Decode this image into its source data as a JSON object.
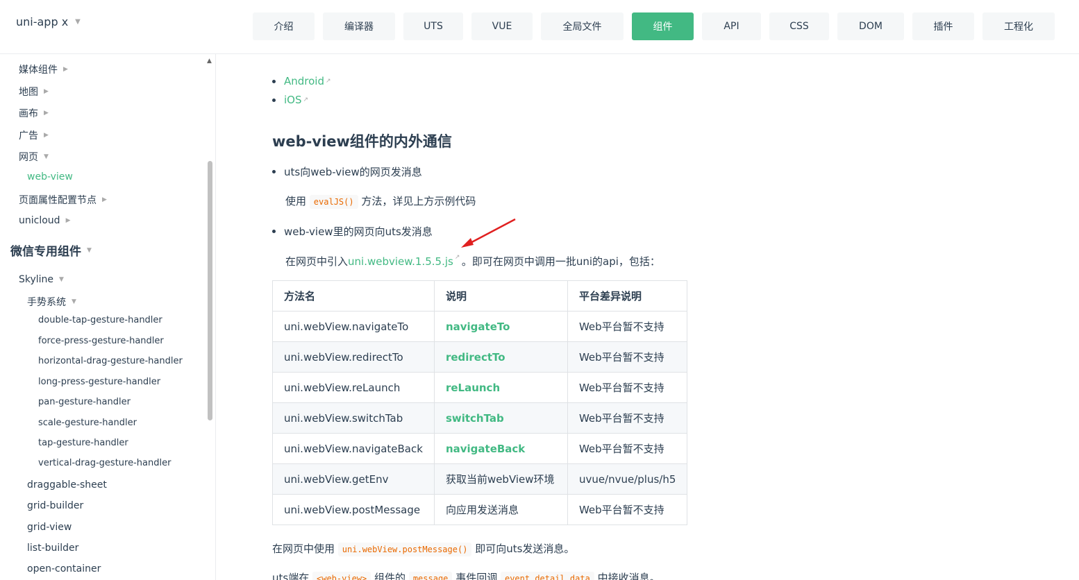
{
  "navbar": {
    "brand": "uni-app x",
    "items": [
      {
        "label": "介绍",
        "w": 89
      },
      {
        "label": "编译器",
        "w": 104
      },
      {
        "label": "UTS",
        "w": 86
      },
      {
        "label": "VUE",
        "w": 88
      },
      {
        "label": "全局文件",
        "w": 119
      },
      {
        "label": "组件",
        "w": 89,
        "active": true
      },
      {
        "label": "API",
        "w": 85
      },
      {
        "label": "CSS",
        "w": 86
      },
      {
        "label": "DOM",
        "w": 96
      },
      {
        "label": "插件",
        "w": 89
      },
      {
        "label": "工程化",
        "w": 104
      }
    ]
  },
  "sidebar": {
    "items": [
      {
        "label": "媒体组件",
        "arrow": "▶"
      },
      {
        "label": "地图",
        "arrow": "▶"
      },
      {
        "label": "画布",
        "arrow": "▶"
      },
      {
        "label": "广告",
        "arrow": "▶"
      },
      {
        "label": "网页",
        "arrow": "▼"
      },
      {
        "label": "web-view"
      },
      {
        "label": "页面属性配置节点",
        "arrow": "▶"
      },
      {
        "label": "unicloud",
        "arrow": "▶"
      },
      {
        "label": "微信专用组件",
        "arrow": "▼"
      },
      {
        "label": "Skyline",
        "arrow": "▼"
      },
      {
        "label": "手势系统",
        "arrow": "▼"
      },
      {
        "label": "double-tap-gesture-handler"
      },
      {
        "label": "force-press-gesture-handler"
      },
      {
        "label": "horizontal-drag-gesture-handler"
      },
      {
        "label": "long-press-gesture-handler"
      },
      {
        "label": "pan-gesture-handler"
      },
      {
        "label": "scale-gesture-handler"
      },
      {
        "label": "tap-gesture-handler"
      },
      {
        "label": "vertical-drag-gesture-handler"
      },
      {
        "label": "draggable-sheet"
      },
      {
        "label": "grid-builder"
      },
      {
        "label": "grid-view"
      },
      {
        "label": "list-builder"
      },
      {
        "label": "open-container"
      }
    ]
  },
  "content": {
    "platform_links": [
      "Android",
      "iOS"
    ],
    "heading": "web-view组件的内外通信",
    "bullet1": "uts向web-view的网页发消息",
    "p1_pre": "使用",
    "p1_code": "evalJS()",
    "p1_post": "方法，详见上方示例代码",
    "bullet2": "web-view里的网页向uts发消息",
    "p2_pre": "在网页中引入",
    "p2_link": "uni.webview.1.5.5.js",
    "p2_post": "。即可在网页中调用一批uni的api，包括：",
    "table": {
      "headers": [
        "方法名",
        "说明",
        "平台差异说明"
      ],
      "rows": [
        [
          "uni.webView.navigateTo",
          "navigateTo",
          "Web平台暂不支持"
        ],
        [
          "uni.webView.redirectTo",
          "redirectTo",
          "Web平台暂不支持"
        ],
        [
          "uni.webView.reLaunch",
          "reLaunch",
          "Web平台暂不支持"
        ],
        [
          "uni.webView.switchTab",
          "switchTab",
          "Web平台暂不支持"
        ],
        [
          "uni.webView.navigateBack",
          "navigateBack",
          "Web平台暂不支持"
        ],
        [
          "uni.webView.getEnv",
          "获取当前webView环境",
          "uvue/nvue/plus/h5"
        ],
        [
          "uni.webView.postMessage",
          "向应用发送消息",
          "Web平台暂不支持"
        ]
      ],
      "link_rows": [
        true,
        true,
        true,
        true,
        true,
        false,
        false
      ]
    },
    "p3_pre": "在网页中使用",
    "p3_code": "uni.webView.postMessage()",
    "p3_post": "即可向uts发送消息。",
    "p4_pre": "uts端在",
    "p4_code1": "<web-view>",
    "p4_mid1": "组件的",
    "p4_code2": "message",
    "p4_mid2": "事件回调",
    "p4_code3": "event.detail.data",
    "p4_post": "中接收消息。"
  },
  "colors": {
    "accent": "#42b983",
    "text": "#2c3e50",
    "code": "#e96900",
    "annotation": "#e02020"
  }
}
